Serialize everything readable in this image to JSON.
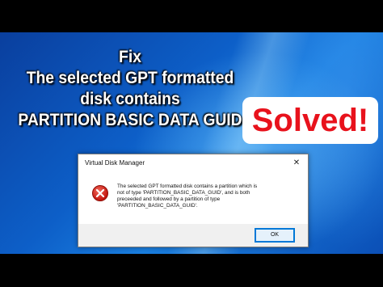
{
  "headline": {
    "line1": "Fix",
    "line2": "The selected GPT formatted",
    "line3": "disk contains",
    "line4": "PARTITION BASIC DATA GUID"
  },
  "badge": {
    "text": "Solved!"
  },
  "dialog": {
    "title": "Virtual Disk Manager",
    "close_glyph": "✕",
    "message_lines": [
      "The selected GPT formatted disk contains a partition which is",
      "not of type 'PARTITION_BASIC_DATA_GUID', and is both",
      "preceeded and followed by a partition of type",
      "'PARTITION_BASIC_DATA_GUID'."
    ],
    "ok_label": "OK",
    "icon": "error-icon"
  },
  "colors": {
    "badge_text": "#e8121c",
    "desktop_blue": "#0d5fc8",
    "button_accent": "#0078d7"
  }
}
